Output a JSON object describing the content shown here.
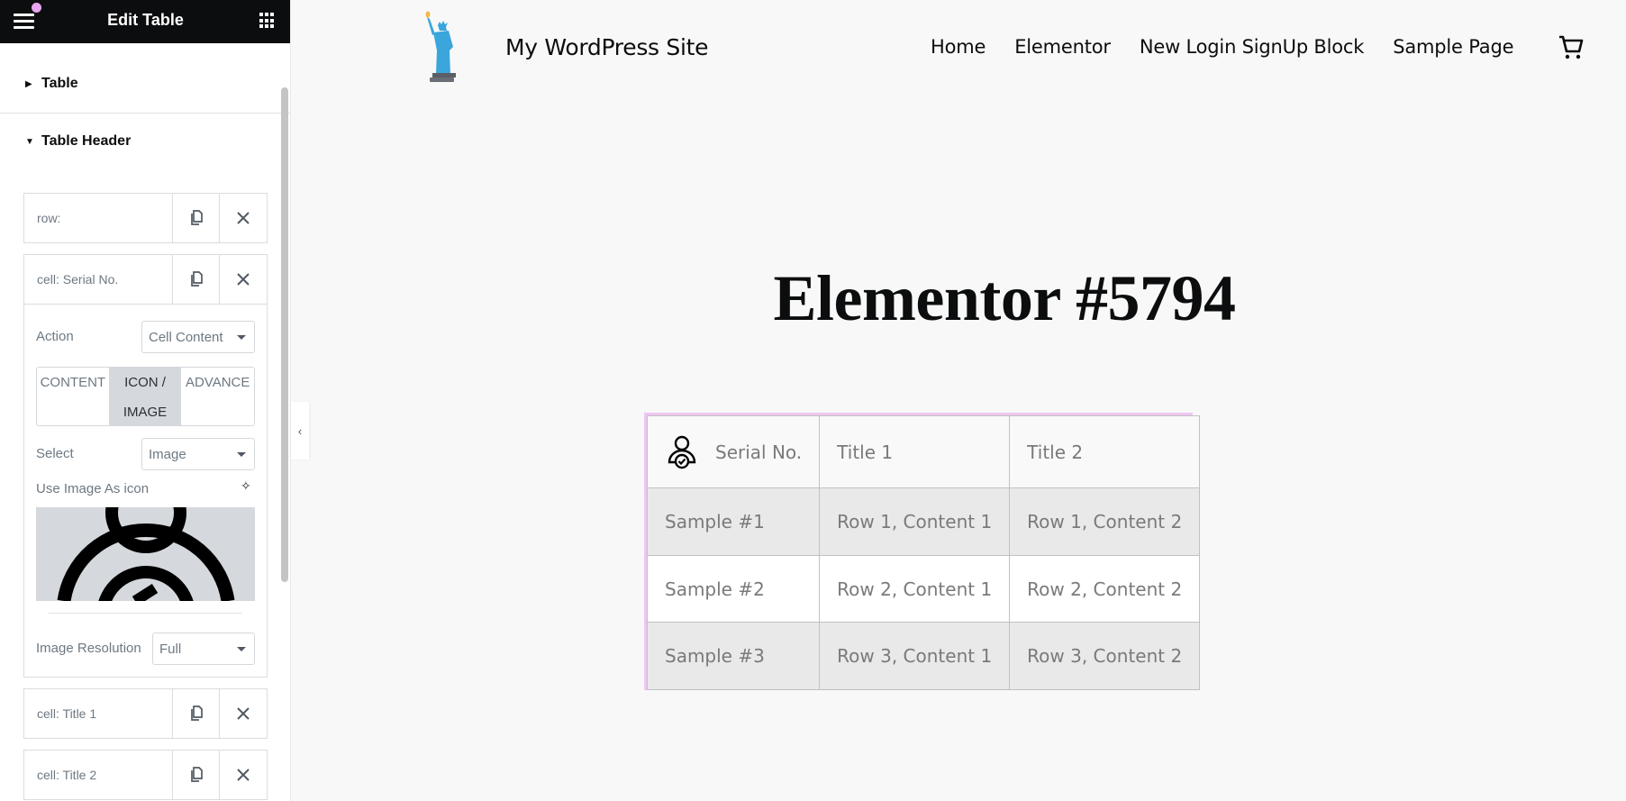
{
  "panel": {
    "title": "Edit Table",
    "sections": [
      {
        "label": "Table",
        "expanded": false
      },
      {
        "label": "Table Header",
        "expanded": true
      }
    ],
    "repeater_items": [
      {
        "title": "row:"
      },
      {
        "title": "cell: Serial No.",
        "expanded": true
      },
      {
        "title": "cell: Title 1"
      },
      {
        "title": "cell: Title 2"
      }
    ],
    "cell_editor": {
      "action_label": "Action",
      "action_value": "Cell Content",
      "tabs": [
        "CONTENT",
        "ICON / IMAGE",
        "ADVANCE"
      ],
      "active_tab": "ICON / IMAGE",
      "tab_icon_line1": "ICON /",
      "tab_icon_line2": "IMAGE",
      "select_label": "Select",
      "select_value": "Image",
      "use_image_label": "Use Image As icon",
      "resolution_label": "Image Resolution",
      "resolution_value": "Full"
    },
    "notification_color": "#e8a5f0"
  },
  "site": {
    "name": "My WordPress Site",
    "nav": [
      "Home",
      "Elementor",
      "New Login SignUp Block",
      "Sample Page"
    ],
    "page_title": "Elementor #5794"
  },
  "table": {
    "headers": [
      "Serial No.",
      "Title 1",
      "Title 2"
    ],
    "rows": [
      [
        "Sample #1",
        "Row 1, Content 1",
        "Row 1, Content 2"
      ],
      [
        "Sample #2",
        "Row 2, Content 1",
        "Row 2, Content 2"
      ],
      [
        "Sample #3",
        "Row 3, Content 1",
        "Row 3, Content 2"
      ]
    ],
    "selection_color": "#efc6f2"
  }
}
